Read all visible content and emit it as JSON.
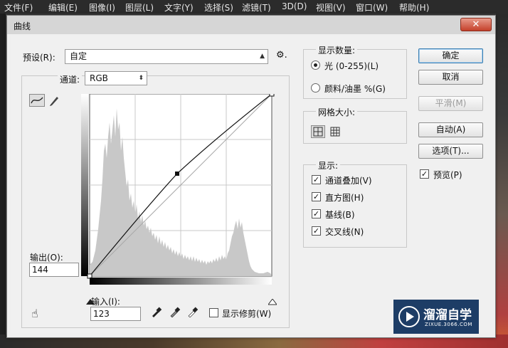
{
  "app": {
    "menu": [
      "文件(F)",
      "编辑(E)",
      "图像(I)",
      "图层(L)",
      "文字(Y)",
      "选择(S)",
      "滤镜(T)",
      "3D(D)",
      "视图(V)",
      "窗口(W)",
      "帮助(H)"
    ]
  },
  "dialog": {
    "title": "曲线",
    "close_label": "✕",
    "preset_label": "预设(R):",
    "preset_value": "自定",
    "channel_label": "通道:",
    "channel_value": "RGB",
    "output_label": "输出(O):",
    "output_value": "144",
    "input_label": "输入(I):",
    "input_value": "123",
    "show_clipping_label": "显示修剪(W)",
    "show_clipping_checked": false,
    "show_amount": {
      "title": "显示数量:",
      "options": [
        {
          "label": "光 (0-255)(L)",
          "selected": true
        },
        {
          "label": "颜料/油墨 %(G)",
          "selected": false
        }
      ]
    },
    "grid_size": {
      "title": "网格大小:",
      "selected": "simple-grid"
    },
    "display": {
      "title": "显示:",
      "options": [
        {
          "label": "通道叠加(V)",
          "checked": true
        },
        {
          "label": "直方图(H)",
          "checked": true
        },
        {
          "label": "基线(B)",
          "checked": true
        },
        {
          "label": "交叉线(N)",
          "checked": true
        }
      ]
    },
    "buttons": {
      "ok": "确定",
      "cancel": "取消",
      "smooth": "平滑(M)",
      "auto": "自动(A)",
      "options": "选项(T)..."
    },
    "preview_label": "预览(P)",
    "preview_checked": true,
    "curve": {
      "control_point": {
        "input": 123,
        "output": 144
      },
      "endpoints": [
        {
          "input": 0,
          "output": 0
        },
        {
          "input": 255,
          "output": 255
        }
      ]
    }
  },
  "watermark": {
    "text": "溜溜自学",
    "subtext": "ZIXUE.3066.COM"
  }
}
